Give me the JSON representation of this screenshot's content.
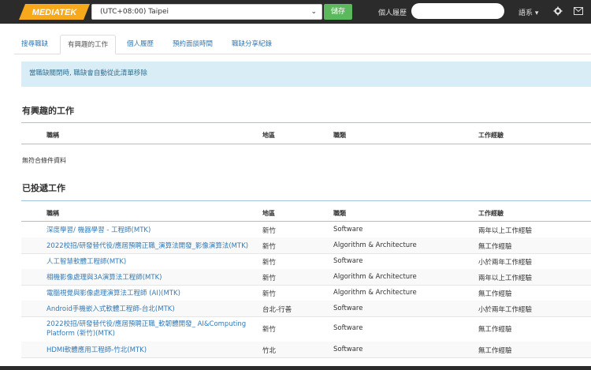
{
  "header": {
    "logo_text": "MEDIATEK",
    "timezone": "(UTC+08:00) Taipei",
    "save_label": "儲存",
    "profile_label": "個人履歷",
    "language_label": "語系",
    "icons": [
      "gear-icon",
      "mail-icon"
    ],
    "colors": {
      "bar": "#2b2b2b",
      "logo": "#f7a81b",
      "save": "#5cb85c"
    }
  },
  "tabs": [
    "搜尋職缺",
    "有興趣的工作",
    "個人履歷",
    "預約面談時間",
    "職缺分享紀錄"
  ],
  "active_tab": "有興趣的工作",
  "alert": "當職缺關閉時, 職缺會自動從此清單移除",
  "interested": {
    "title": "有興趣的工作",
    "columns": [
      "職稱",
      "地區",
      "職類",
      "工作經驗"
    ],
    "empty_text": "無符合條件資料"
  },
  "applied": {
    "title": "已投遞工作",
    "columns": [
      "職稱",
      "地區",
      "職類",
      "工作經驗"
    ],
    "rows": [
      {
        "title": "深度學習/ 機器學習 - 工程師(MTK)",
        "region": "新竹",
        "category": "Software",
        "experience": "兩年以上工作經驗"
      },
      {
        "title": "2022校招/研發替代役/應屆預聘正職_演算法開發_影像演算法(MTK)",
        "region": "新竹",
        "category": "Algorithm & Architecture",
        "experience": "無工作經驗"
      },
      {
        "title": "人工智慧軟體工程師(MTK)",
        "region": "新竹",
        "category": "Software",
        "experience": "小於兩年工作經驗"
      },
      {
        "title": "相機影像處理與3A演算法工程師(MTK)",
        "region": "新竹",
        "category": "Algorithm & Architecture",
        "experience": "兩年以上工作經驗"
      },
      {
        "title": "電腦視覺與影像處理演算法工程師 (AI)(MTK)",
        "region": "新竹",
        "category": "Algorithm & Architecture",
        "experience": "無工作經驗"
      },
      {
        "title": "Android手機嵌入式軟體工程師-台北(MTK)",
        "region": "台北-行善",
        "category": "Software",
        "experience": "小於兩年工作經驗"
      },
      {
        "title": "2022校招/研發替代役/應屆預聘正職_軟韌體開發_ AI&Computing Platform (新竹)(MTK)",
        "region": "新竹",
        "category": "Software",
        "experience": "無工作經驗"
      },
      {
        "title": "HDMI軟體應用工程師-竹北(MTK)",
        "region": "竹北",
        "category": "Software",
        "experience": "無工作經驗"
      }
    ]
  }
}
